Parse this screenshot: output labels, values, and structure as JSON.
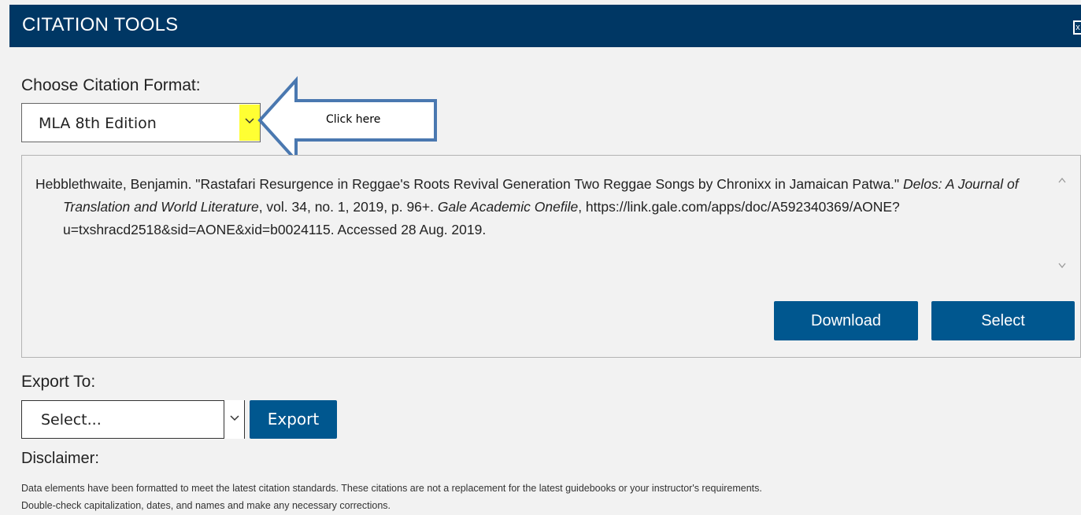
{
  "header": {
    "title": "CITATION TOOLS",
    "close_label": "x"
  },
  "format": {
    "label": "Choose Citation Format:",
    "selected": "MLA 8th Edition"
  },
  "annotation": {
    "text": "Click here"
  },
  "citation": {
    "part1": "Hebblethwaite, Benjamin. \"Rastafari Resurgence in Reggae's Roots Revival Generation Two Reggae Songs by Chronixx in Jamaican Patwa.\" ",
    "journal": "Delos: A Journal of Translation and World Literature",
    "part2": ", vol. 34, no. 1, 2019, p. 96+. ",
    "database": "Gale Academic Onefile",
    "part3": ", https://link.gale.com/apps/doc/A592340369/AONE?u=txshracd2518&sid=AONE&xid=b0024115. Accessed 28 Aug. 2019."
  },
  "actions": {
    "download_label": "Download",
    "select_label": "Select"
  },
  "export": {
    "label": "Export To:",
    "selected": "Select...",
    "button_label": "Export"
  },
  "disclaimer": {
    "label": "Disclaimer:",
    "line1": "Data elements have been formatted to meet the latest citation standards. These citations are not a replacement for the latest guidebooks or your instructor's requirements.",
    "line2": "Double-check capitalization, dates, and names and make any necessary corrections."
  },
  "colors": {
    "header_bg": "#003764",
    "button_bg": "#00578f",
    "highlight": "#ffff33",
    "callout_stroke": "#4a78b0"
  }
}
